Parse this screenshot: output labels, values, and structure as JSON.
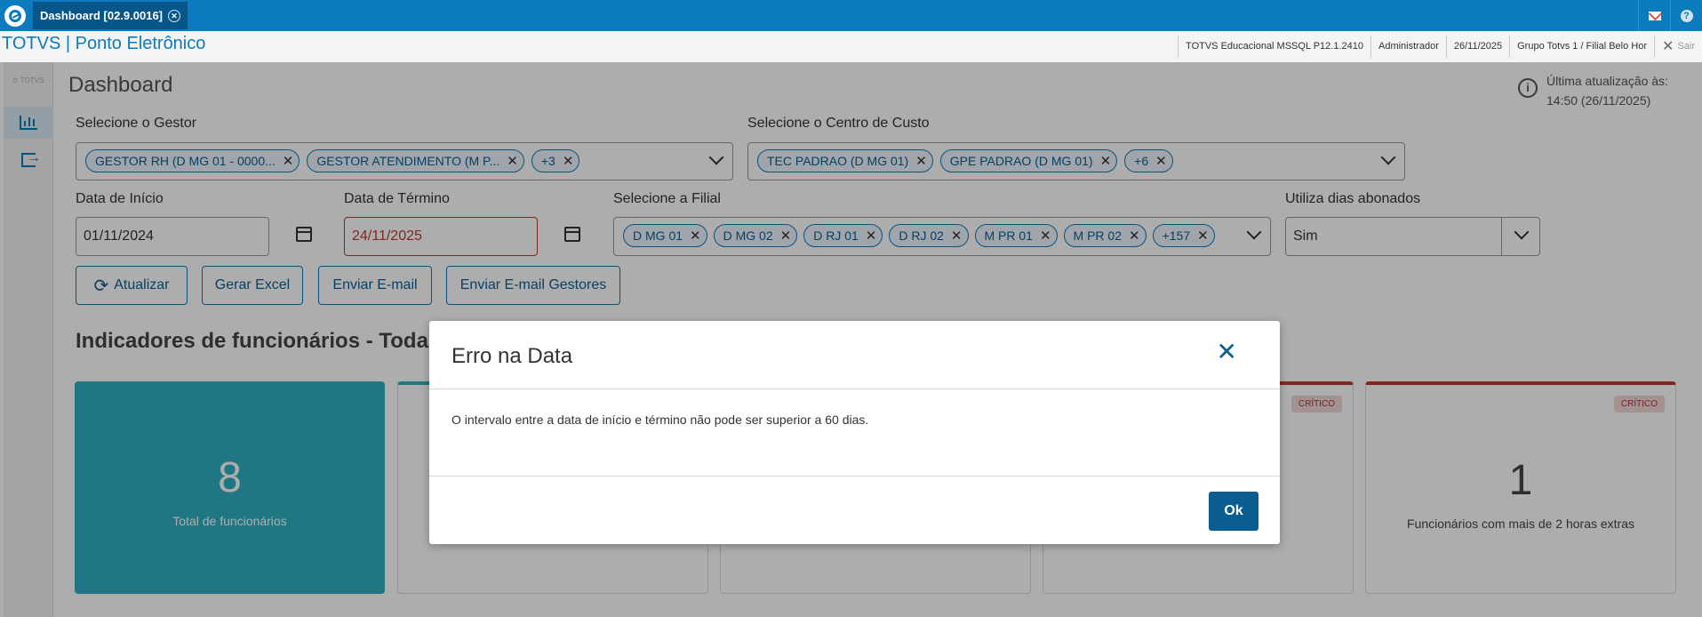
{
  "tab": {
    "title": "Dashboard [02.9.0016]"
  },
  "header": {
    "product": "TOTVS | Ponto Eletrônico"
  },
  "status_bar": {
    "database": "TOTVS Educacional MSSQL P12.1.2410",
    "user": "Administrador",
    "date": "26/11/2025",
    "branch": "Grupo Totvs 1 / Filial Belo Hor",
    "exit": "Sair"
  },
  "sidebar": {
    "brand": "TOTVS"
  },
  "page": {
    "title": "Dashboard",
    "last_update_label": "Última atualização às:",
    "last_update_value": "14:50 (26/11/2025)"
  },
  "filters": {
    "gestor": {
      "label": "Selecione o Gestor",
      "chips": [
        "GESTOR RH (D MG 01 - 0000...",
        "GESTOR ATENDIMENTO (M P...",
        "+3"
      ]
    },
    "centro_custo": {
      "label": "Selecione o Centro de Custo",
      "chips": [
        "TEC PADRAO (D MG 01)",
        "GPE PADRAO (D MG 01)",
        "+6"
      ]
    },
    "data_inicio": {
      "label": "Data de Início",
      "value": "01/11/2024"
    },
    "data_termino": {
      "label": "Data de Término",
      "value": "24/11/2025"
    },
    "filial": {
      "label": "Selecione a Filial",
      "chips": [
        "D MG 01",
        "D MG 02",
        "D RJ 01",
        "D RJ 02",
        "M PR 01",
        "M PR 02",
        "+157"
      ]
    },
    "dias_abonados": {
      "label": "Utiliza dias abonados",
      "value": "Sim"
    }
  },
  "actions": {
    "atualizar": "Atualizar",
    "gerar_excel": "Gerar Excel",
    "enviar_email": "Enviar E-mail",
    "enviar_email_gestores": "Enviar E-mail Gestores"
  },
  "section": {
    "title": "Indicadores de funcionários - Todas a"
  },
  "cards": {
    "total": {
      "value": "8",
      "label": "Total de funcionários"
    },
    "critico_badge": "CRÍTICO",
    "horas_extras": {
      "value": "1",
      "label": "Funcionários com mais de 2 horas extras"
    }
  },
  "modal": {
    "title": "Erro na Data",
    "message": "O intervalo entre a data de início e término não pode ser superior a 60 dias.",
    "ok": "Ok"
  }
}
